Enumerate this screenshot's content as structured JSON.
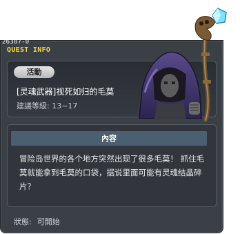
{
  "window": {
    "quest_id": "26387-0",
    "title": "QUEST INFO"
  },
  "quest": {
    "category": "活動",
    "name": "[灵魂武器]视死如归的毛莫",
    "level_label": "建議等級:",
    "level_range": "13~17"
  },
  "content": {
    "header": "內容",
    "description": "冒险岛世界的各个地方突然出现了很多毛莫！ 抓住毛莫就能拿到毛莫的口袋，据说里面可能有灵魂结晶碎片？"
  },
  "status": {
    "label": "狀態:",
    "value": "可開始"
  },
  "icons": {
    "npc": "hooded-reaper-npc-portrait",
    "staff": "crystal-staff-icon"
  }
}
